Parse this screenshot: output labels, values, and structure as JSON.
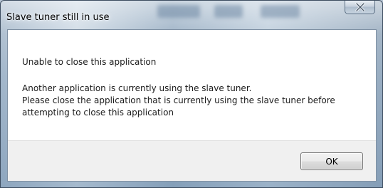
{
  "window": {
    "title": "Slave tuner still in use",
    "close_icon": "close-icon"
  },
  "dialog": {
    "heading": "Unable to close this application",
    "message_lines": [
      "Another application is currently using the slave tuner.",
      "Please close the application that is currently using the slave tuner before",
      "attempting to close this application"
    ]
  },
  "buttons": {
    "ok_label": "OK"
  },
  "colors": {
    "frame": "#9fb3c7",
    "client_background": "#ffffff",
    "button_area": "#f0f0f0"
  }
}
